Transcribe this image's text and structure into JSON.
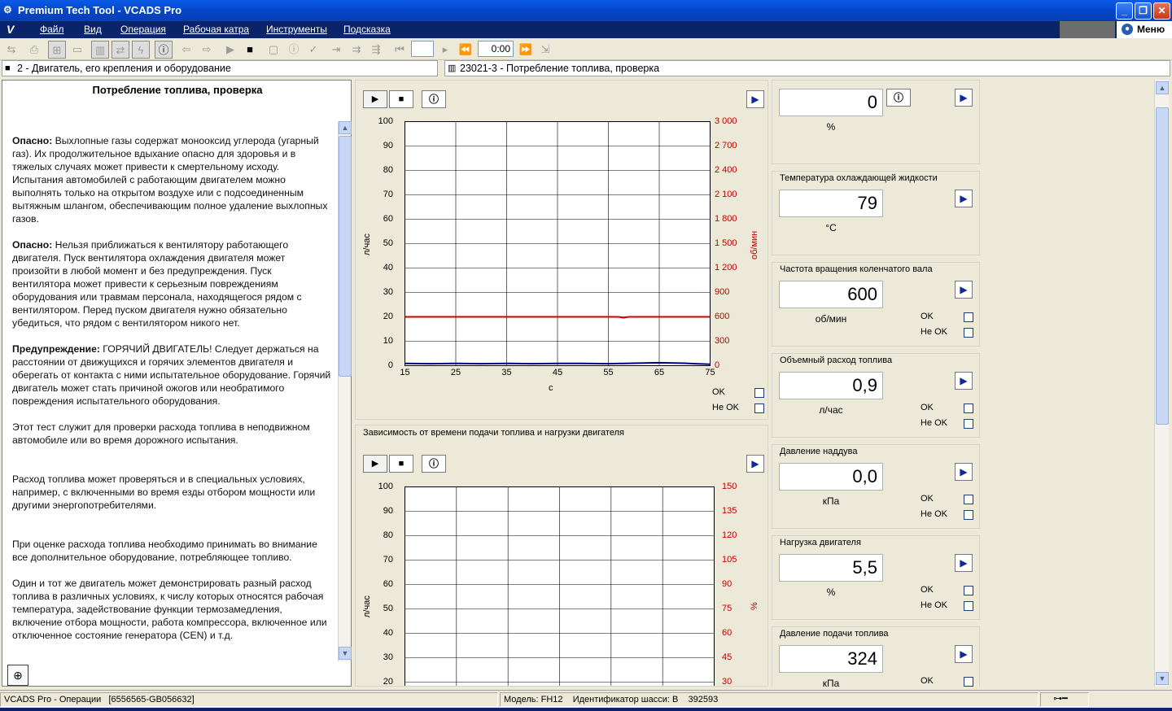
{
  "window": {
    "title": "Premium Tech Tool - VCADS Pro"
  },
  "menu": {
    "items": [
      "Файл",
      "Вид",
      "Операция",
      "Рабочая катра",
      "Инструменты",
      "Подсказка"
    ],
    "menu_button": "Меню"
  },
  "toolbar": {
    "time_value": "0:00"
  },
  "breadcrumbs": {
    "left": "2 - Двигатель, его крепления и оборудование",
    "right": "23021-3 - Потребление топлива, проверка"
  },
  "instructions": {
    "title": "Потребление топлива, проверка",
    "paragraphs": [
      {
        "label": "Опасно:",
        "text": " Выхлопные газы содержат монооксид углерода (угарный газ). Их продолжительное вдыхание опасно для здоровья и в тяжелых случаях может привести к смертельному исходу. Испытания автомобилей с работающим двигателем можно выполнять только на открытом воздухе или с подсоединенным вытяжным шлангом, обеспечивающим полное удаление выхлопных газов."
      },
      {
        "label": "Опасно:",
        "text": " Нельзя приближаться к вентилятору работающего двигателя. Пуск вентилятора охлаждения двигателя может произойти в любой момент и без предупреждения. Пуск вентилятора может привести к серьезным повреждениям оборудования или травмам персонала, находящегося рядом с вентилятором. Перед пуском двигателя нужно обязательно убедиться, что рядом с вентилятором никого нет."
      },
      {
        "label": "Предупреждение:",
        "text": " ГОРЯЧИЙ ДВИГАТЕЛЬ! Следует держаться на расстоянии от движущихся и горячих элементов двигателя и оберегать от контакта с ними испытательное оборудование. Горячий двигатель может стать причиной ожогов или необратимого повреждения испытательного оборудования."
      },
      {
        "label": "",
        "text": "Этот тест служит для проверки расхода топлива в неподвижном автомобиле или во время дорожного испытания."
      },
      {
        "label": "",
        "text": "Расход топлива может проверяться и в специальных условиях, например, с включенными во время езды отбором мощности или другими энергопотребителями."
      },
      {
        "label": "",
        "text": "При оценке расхода топлива необходимо принимать во внимание все дополнительное оборудование, потребляющее топливо."
      },
      {
        "label": "",
        "text": "Один и тот же двигатель может демонстрировать разный расход топлива в различных условиях, к числу которых относятся рабочая температура, задействование функции термозамедления, включение отбора мощности, работа компрессора, включенное или отключенное состояние генератора (CEN) и т.д."
      }
    ]
  },
  "chart_data": [
    {
      "type": "line",
      "title": "",
      "xlabel": "с",
      "ylabel": "л/час",
      "ylabel_right": "об/мин",
      "xlim": [
        15,
        75
      ],
      "x_ticks": [
        15,
        25,
        35,
        45,
        55,
        65,
        75
      ],
      "ylim": [
        0,
        100
      ],
      "y_ticks": [
        0,
        10,
        20,
        30,
        40,
        50,
        60,
        70,
        80,
        90,
        100
      ],
      "ylim_right": [
        0,
        3000
      ],
      "y_ticks_right": [
        "0",
        "300",
        "600",
        "900",
        "1 200",
        "1 500",
        "1 800",
        "2 100",
        "2 400",
        "2 700",
        "3 000"
      ],
      "grid": true,
      "series": [
        {
          "axis": "right",
          "color": "#cc0000",
          "x": [
            15,
            57,
            58,
            59,
            75
          ],
          "values": [
            600,
            600,
            590,
            600,
            600
          ]
        },
        {
          "axis": "left",
          "color": "#000080",
          "x": [
            15,
            20,
            25,
            30,
            35,
            40,
            45,
            50,
            55,
            60,
            65,
            70,
            72,
            75
          ],
          "values": [
            0.9,
            0.8,
            0.9,
            0.8,
            0.9,
            0.8,
            0.9,
            0.9,
            0.8,
            1.0,
            1.2,
            1.0,
            0.8,
            0.6
          ]
        }
      ],
      "ok_label": "OK",
      "not_ok_label": "Не OK"
    },
    {
      "type": "line",
      "title": "Зависимость от времени подачи топлива и нагрузки двигателя",
      "xlabel": "",
      "ylabel": "л/час",
      "ylabel_right": "%",
      "ylim": [
        0,
        100
      ],
      "y_ticks_visible": [
        20,
        30,
        40,
        50,
        60,
        70,
        80,
        90,
        100
      ],
      "ylim_right": [
        0,
        150
      ],
      "y_ticks_right_visible": [
        "30",
        "45",
        "60",
        "75",
        "90",
        "105",
        "120",
        "135",
        "150"
      ],
      "grid": true,
      "series": []
    }
  ],
  "gauges": [
    {
      "title": "",
      "value": "0",
      "unit": "%",
      "has_info": true,
      "has_checks": false
    },
    {
      "title": "Температура охлаждающей жидкости",
      "value": "79",
      "unit": "°C",
      "has_checks": false
    },
    {
      "title": "Частота вращения коленчатого вала",
      "value": "600",
      "unit": "об/мин",
      "has_checks": true
    },
    {
      "title": "Объемный расход топлива",
      "value": "0,9",
      "unit": "л/час",
      "has_checks": true
    },
    {
      "title": "Давление наддува",
      "value": "0,0",
      "unit": "кПа",
      "has_checks": true
    },
    {
      "title": "Нагрузка двигателя",
      "value": "5,5",
      "unit": "%",
      "has_checks": true
    },
    {
      "title": "Давление подачи топлива",
      "value": "324",
      "unit": "кПа",
      "has_checks": true
    }
  ],
  "check_labels": {
    "ok": "OK",
    "not_ok": "Не OK"
  },
  "status": {
    "app": "VCADS Pro - Операции",
    "id": "[6556565-GB056632]",
    "model": "Модель: FH12",
    "chassis": "Идентификатор шасси: B    392593"
  },
  "colors": {
    "accent": "#0a246a",
    "series_rpm": "#cc0000",
    "series_fuel": "#000080"
  }
}
